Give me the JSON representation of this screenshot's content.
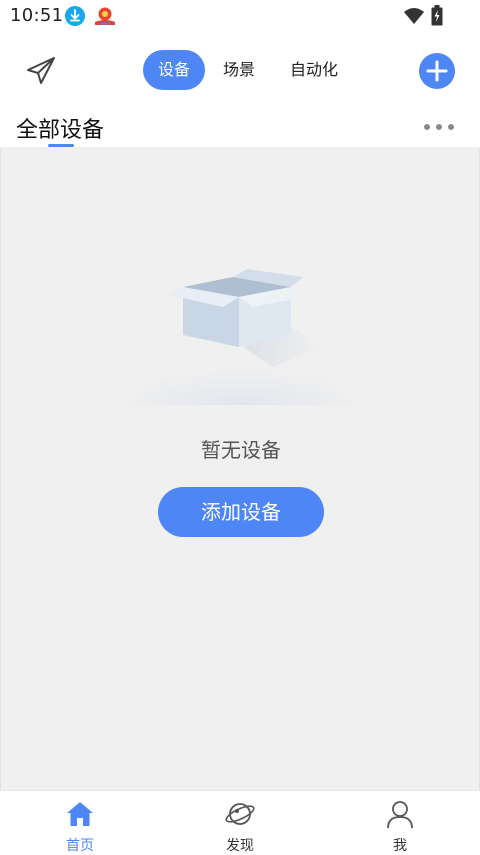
{
  "status_bar": {
    "time": "10:51",
    "icons": [
      "download-icon",
      "app-notification-icon",
      "wifi-icon",
      "battery-charging-icon"
    ]
  },
  "top_bar": {
    "send_icon": "paper-plane-icon",
    "tabs": [
      {
        "label": "设备",
        "active": true
      },
      {
        "label": "场景",
        "active": false
      },
      {
        "label": "自动化",
        "active": false
      }
    ],
    "add_icon": "plus-icon"
  },
  "section": {
    "title": "全部设备",
    "more_icon": "more-dots-icon"
  },
  "empty_state": {
    "illustration": "empty-box-icon",
    "message": "暂无设备",
    "button_label": "添加设备"
  },
  "bottom_nav": {
    "items": [
      {
        "label": "首页",
        "icon": "home-icon",
        "active": true
      },
      {
        "label": "发现",
        "icon": "planet-icon",
        "active": false
      },
      {
        "label": "我",
        "icon": "user-icon",
        "active": false
      }
    ]
  },
  "colors": {
    "accent": "#4e86f6",
    "content_background": "#f0f0f0",
    "text_primary": "#111111",
    "text_secondary": "#555555"
  }
}
